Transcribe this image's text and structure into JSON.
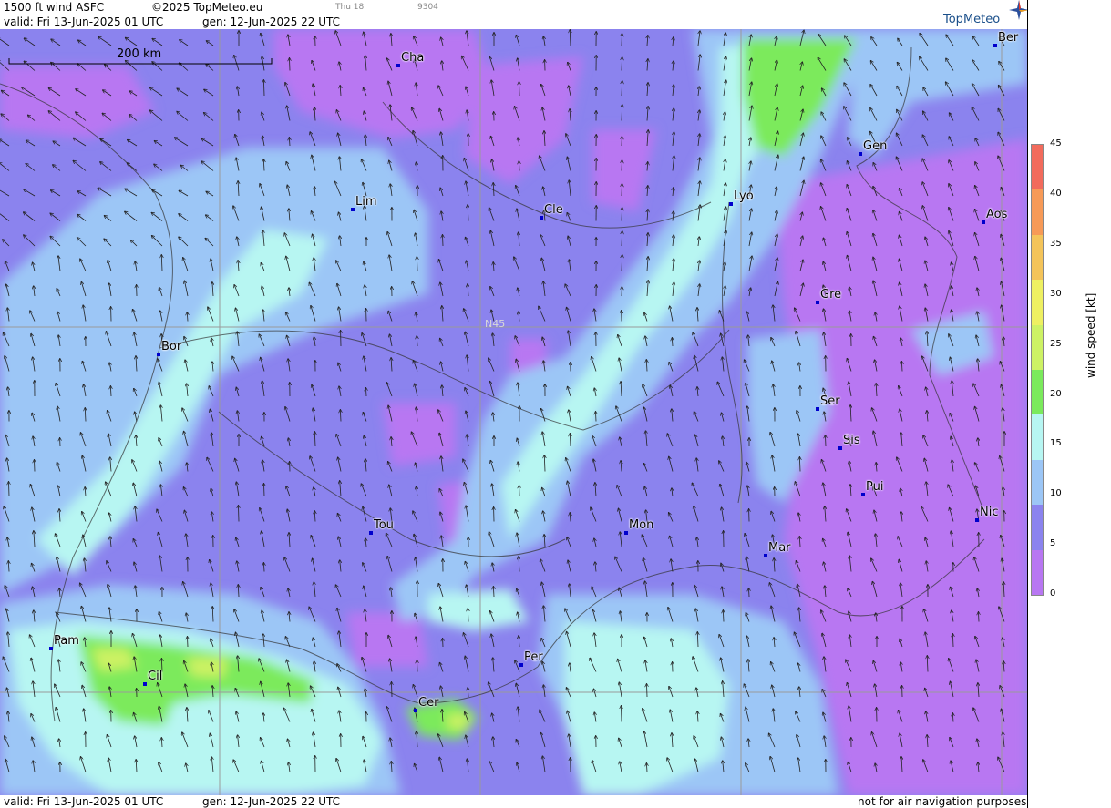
{
  "header": {
    "product": "1500 ft wind ASFC",
    "copyright": "©2025 TopMeteo.eu",
    "day_hint": "Thu 18",
    "code_hint": "9304",
    "valid": "valid:  Fri  13-Jun-2025  01 UTC",
    "gen": "gen: 12-Jun-2025 22 UTC"
  },
  "logo": {
    "text": "TopMeteo",
    "icon": "compass-star-icon"
  },
  "scale": {
    "label": "200 km"
  },
  "grid": {
    "lat_label": "N45"
  },
  "cities": [
    {
      "name": "Ber"
    },
    {
      "name": "Cha"
    },
    {
      "name": "Gen"
    },
    {
      "name": "Lim"
    },
    {
      "name": "Cle"
    },
    {
      "name": "Lyo"
    },
    {
      "name": "Aos"
    },
    {
      "name": "Gre"
    },
    {
      "name": "Bor"
    },
    {
      "name": "Ser"
    },
    {
      "name": "Sis"
    },
    {
      "name": "Pui"
    },
    {
      "name": "Tou"
    },
    {
      "name": "Mon"
    },
    {
      "name": "Nic"
    },
    {
      "name": "Mar"
    },
    {
      "name": "Pam"
    },
    {
      "name": "Per"
    },
    {
      "name": "Cil"
    },
    {
      "name": "Cer"
    }
  ],
  "legend": {
    "title": "wind speed [kt]",
    "ticks": [
      "45",
      "40",
      "35",
      "30",
      "25",
      "20",
      "15",
      "10",
      "5",
      "0"
    ],
    "colors": [
      "#f26b5c",
      "#f79a57",
      "#f4c45a",
      "#eef061",
      "#cdf264",
      "#7bea5c",
      "#b7f6f2",
      "#9cc6f6",
      "#8b83ee",
      "#b877f2"
    ]
  },
  "footer": {
    "valid": "valid:  Fri  13-Jun-2025  01 UTC",
    "gen": "gen: 12-Jun-2025 22 UTC",
    "disclaimer": "not for air navigation purposes"
  }
}
